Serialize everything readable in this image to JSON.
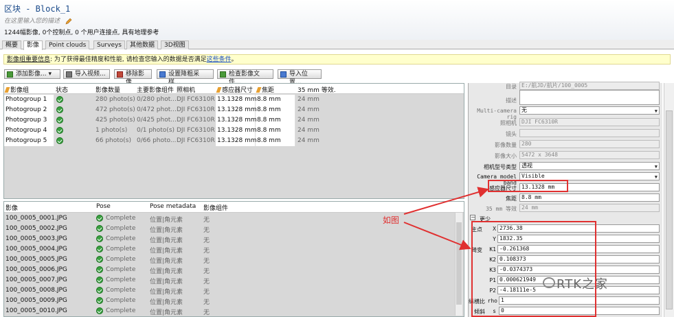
{
  "header": {
    "title": "区块 - Block_1",
    "description_placeholder": "在这里输入您的描述",
    "summary": "1244幅影像, 0个控制点, 0 个用户连接点, 具有地理参考"
  },
  "tabs": [
    {
      "label": "概要"
    },
    {
      "label": "影像"
    },
    {
      "label": "Point clouds"
    },
    {
      "label": "Surveys"
    },
    {
      "label": "其他数据"
    },
    {
      "label": "3D视图"
    }
  ],
  "notice": {
    "title": "影像组重要信息",
    "text": ": 为了获得最佳精度和性能, 请检查您输入的数据是否满足",
    "link": "这些条件",
    "end": "。"
  },
  "toolbar": {
    "add": "添加影像... ▾",
    "import_video": "导入视频...",
    "remove": "移除影像",
    "downsample": "设置降粗采样...",
    "check_files": "检查影像文件...",
    "import_pos": "导入位置..."
  },
  "groups": {
    "headers": [
      "影像组",
      "状态",
      "影像数量",
      "主要影像组件",
      "照相机",
      "感应器尺寸",
      "焦距",
      "35 mm 等效."
    ],
    "rows": [
      {
        "name": "Photogroup 1",
        "count": "280 photo(s)",
        "comp": "0/280 phot...",
        "camera": "DJI FC6310R",
        "sensor": "13.1328 mm",
        "focal": "8.8 mm",
        "eq": "24 mm"
      },
      {
        "name": "Photogroup 2",
        "count": "472 photo(s)",
        "comp": "0/472 phot...",
        "camera": "DJI FC6310R",
        "sensor": "13.1328 mm",
        "focal": "8.8 mm",
        "eq": "24 mm"
      },
      {
        "name": "Photogroup 3",
        "count": "425 photo(s)",
        "comp": "0/425 phot...",
        "camera": "DJI FC6310R",
        "sensor": "13.1328 mm",
        "focal": "8.8 mm",
        "eq": "24 mm"
      },
      {
        "name": "Photogroup 4",
        "count": "1 photo(s)",
        "comp": "0/1 photo(s)",
        "camera": "DJI FC6310R",
        "sensor": "13.1328 mm",
        "focal": "8.8 mm",
        "eq": "24 mm"
      },
      {
        "name": "Photogroup 5",
        "count": "66 photo(s)",
        "comp": "0/66 photo...",
        "camera": "DJI FC6310R",
        "sensor": "13.1328 mm",
        "focal": "8.8 mm",
        "eq": "24 mm"
      }
    ]
  },
  "images": {
    "headers": [
      "影像",
      "Pose",
      "Pose metadata",
      "影像组件"
    ],
    "rows": [
      {
        "file": "100_0005_0001.JPG",
        "pose": "Complete",
        "meta": "位置|角元素",
        "comp": "无"
      },
      {
        "file": "100_0005_0002.JPG",
        "pose": "Complete",
        "meta": "位置|角元素",
        "comp": "无"
      },
      {
        "file": "100_0005_0003.JPG",
        "pose": "Complete",
        "meta": "位置|角元素",
        "comp": "无"
      },
      {
        "file": "100_0005_0004.JPG",
        "pose": "Complete",
        "meta": "位置|角元素",
        "comp": "无"
      },
      {
        "file": "100_0005_0005.JPG",
        "pose": "Complete",
        "meta": "位置|角元素",
        "comp": "无"
      },
      {
        "file": "100_0005_0006.JPG",
        "pose": "Complete",
        "meta": "位置|角元素",
        "comp": "无"
      },
      {
        "file": "100_0005_0007.JPG",
        "pose": "Complete",
        "meta": "位置|角元素",
        "comp": "无"
      },
      {
        "file": "100_0005_0008.JPG",
        "pose": "Complete",
        "meta": "位置|角元素",
        "comp": "无"
      },
      {
        "file": "100_0005_0009.JPG",
        "pose": "Complete",
        "meta": "位置|角元素",
        "comp": "无"
      },
      {
        "file": "100_0005_0010.JPG",
        "pose": "Complete",
        "meta": "位置|角元素",
        "comp": "无"
      }
    ]
  },
  "props": {
    "dir_label": "目录",
    "dir_value": "E:/航JD/航片/100_0005",
    "desc_label": "描述",
    "rig_label": "Multi-camera rig",
    "rig_value": "无",
    "cam_label": "照相机",
    "cam_value": "DJI FC6310R",
    "lens_label": "镜头",
    "count_label": "影像数量",
    "count_value": "280",
    "size_label": "影像大小",
    "size_value": "5472 x 3648",
    "model_label": "相机型号类型",
    "model_value": "透视",
    "band_label": "Camera model band",
    "band_value": "Visible",
    "sensor_label": "感应器尺寸",
    "sensor_value": "13.1328 mm",
    "focal_label": "焦距",
    "focal_value": "8.8 mm",
    "eq_label": "35 mm 等效",
    "eq_value": "24 mm",
    "more_label": "更少",
    "more_toggle": "−",
    "pp_label": "主点",
    "x_label": "X",
    "x_value": "2736.38",
    "y_label": "Y",
    "y_value": "1832.35",
    "dist_label": "畸变",
    "k1_label": "K1",
    "k1_value": "-0.261368",
    "k2_label": "K2",
    "k2_value": "0.108373",
    "k3_label": "K3",
    "k3_value": "-0.0374373",
    "p1_label": "P1",
    "p1_value": "0.000621949",
    "p2_label": "P2",
    "p2_value": "-4.18111e-5",
    "aspect_label": "纵横比",
    "rho_label": "rho",
    "aspect_value": "1",
    "skew_label": "倾斜",
    "s_label": "s",
    "skew_value": "0"
  },
  "annotation": {
    "note": "如图",
    "watermark": "RTK之家"
  },
  "colors": {
    "annotation_red": "#e03030",
    "notice_bg": "#ffffcc",
    "status_green": "#3aa040"
  }
}
